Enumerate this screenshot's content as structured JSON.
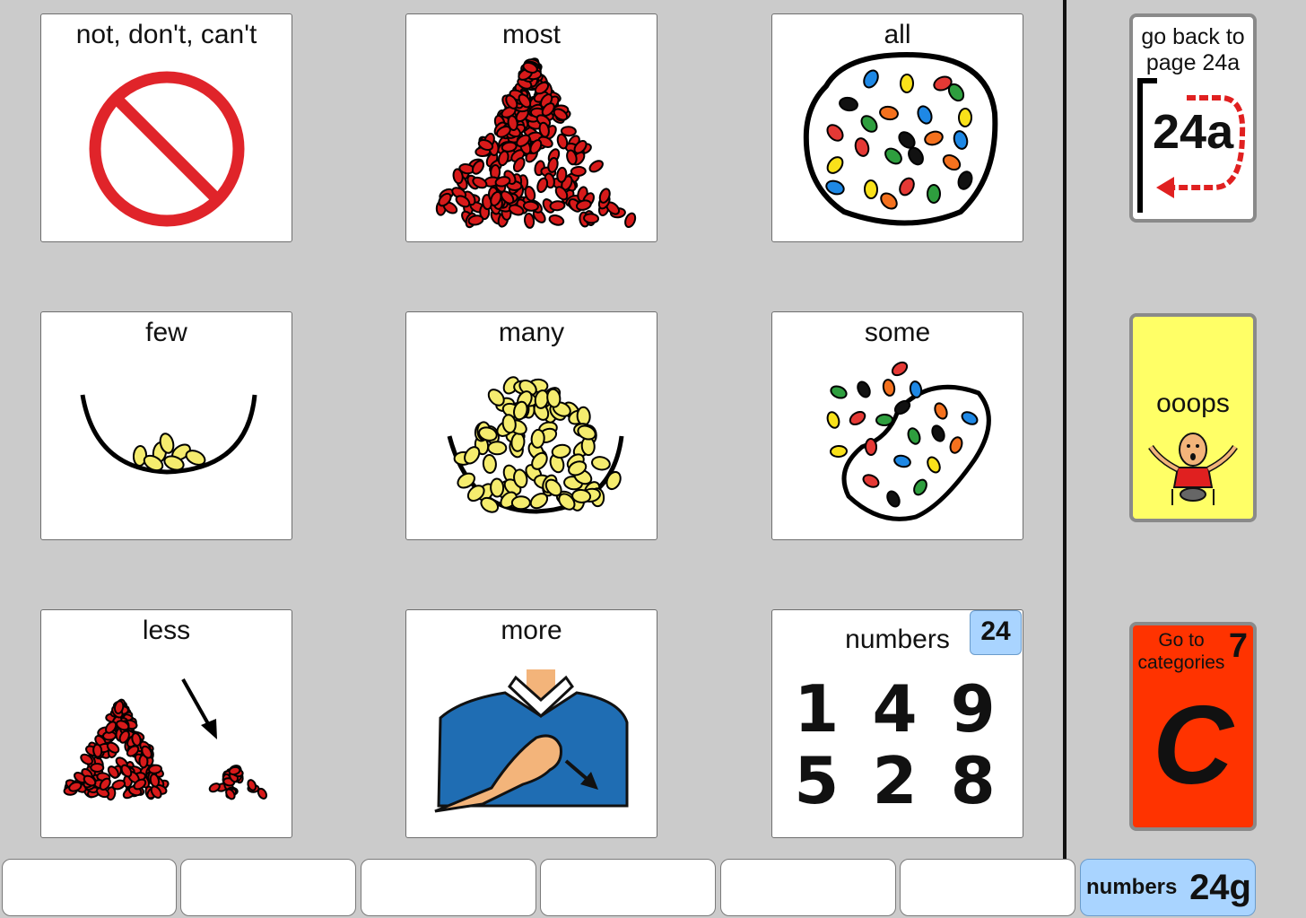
{
  "grid": {
    "cells": [
      {
        "label": "not, don't, can't",
        "icon": "prohibited-icon"
      },
      {
        "label": "most",
        "icon": "big-pile-icon"
      },
      {
        "label": "all",
        "icon": "full-bowl-of-beans-icon"
      },
      {
        "label": "few",
        "icon": "bowl-few-icon"
      },
      {
        "label": "many",
        "icon": "bowl-many-icon"
      },
      {
        "label": "some",
        "icon": "some-beans-icon"
      },
      {
        "label": "less",
        "icon": "piles-less-icon"
      },
      {
        "label": "more",
        "icon": "more-sign-icon"
      },
      {
        "label": "numbers",
        "icon": "numbers-icon",
        "badge": "24",
        "digits_row1": "1 4 9",
        "digits_row2": "5 2 8"
      }
    ]
  },
  "nav": {
    "back_label_line1": "go back to",
    "back_label_line2": "page 24a",
    "back_code": "24a",
    "ooops_label": "ooops",
    "categories_label_line1": "Go to",
    "categories_label_line2": "categories",
    "categories_number": "7",
    "categories_letter": "C"
  },
  "message_bar": {
    "page_label": "numbers",
    "page_code": "24g"
  },
  "colors": {
    "background": "#cbcbcb",
    "red_bean": "#d81a1a",
    "yellow_bean": "#f5ec6e",
    "ooops_bg": "#ffff66",
    "categories_bg": "#ff3300",
    "page_tab_bg": "#a9d4ff"
  }
}
